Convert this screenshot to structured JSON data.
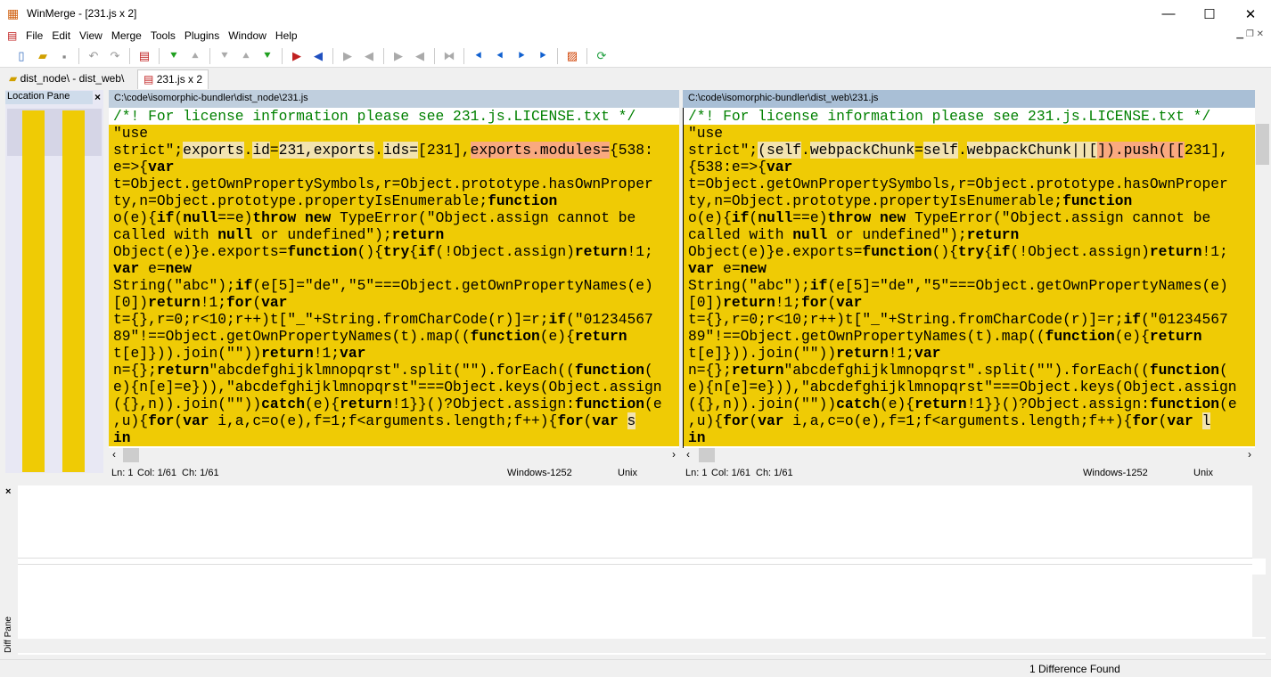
{
  "window": {
    "title": "WinMerge - [231.js x 2]",
    "minimize": "—",
    "maximize": "☐",
    "close": "✕"
  },
  "menu": [
    "File",
    "Edit",
    "View",
    "Merge",
    "Tools",
    "Plugins",
    "Window",
    "Help"
  ],
  "toolbar": [
    "new-icon",
    "open-icon",
    "save-icon",
    "undo-icon",
    "redo-icon",
    "diff-icon",
    "next-diff-icon",
    "prev-diff-icon",
    "first-diff-icon",
    "last-diff-icon",
    "current-diff-icon",
    "copy-right-icon",
    "copy-left-icon",
    "copy-right-advance-icon",
    "copy-left-advance-icon",
    "all-right-icon",
    "all-left-icon",
    "merge-icon",
    "move-left-icon",
    "move-left2-icon",
    "move-right-icon",
    "move-right2-icon",
    "options-icon",
    "refresh-icon"
  ],
  "tabs": [
    {
      "label": "dist_node\\ - dist_web\\"
    },
    {
      "label": "231.js x 2"
    }
  ],
  "location_pane": {
    "title": "Location Pane",
    "close": "×"
  },
  "diff_pane": {
    "title": "Diff Pane",
    "close": "×"
  },
  "colors": {
    "diff": "#efcb05",
    "word_diff": "#f9a97f",
    "word_hl": "#f2e3b0",
    "comment": "#008000"
  },
  "left": {
    "path": "C:\\code\\isomorphic-bundler\\dist_node\\231.js",
    "lines": [
      [
        [
          "/*! For license information please see 231.js.LICENSE.txt */",
          "cm"
        ]
      ],
      "\"use",
      [
        [
          "strict\";",
          ""
        ],
        [
          "exports",
          "hl"
        ],
        [
          ".",
          ""
        ],
        [
          "id",
          "hl"
        ],
        [
          "=",
          ""
        ],
        [
          "231,exports",
          "hl"
        ],
        [
          ".",
          ""
        ],
        [
          "ids=",
          "hl"
        ],
        [
          "[231],",
          ""
        ],
        [
          "exports.modules=",
          "hd"
        ],
        [
          "{538:",
          ""
        ]
      ],
      "e=>{var",
      "t=Object.getOwnPropertySymbols,r=Object.prototype.hasOwnProper",
      "ty,n=Object.prototype.propertyIsEnumerable;function",
      "o(e){if(null==e)throw new TypeError(\"Object.assign cannot be",
      "called with null or undefined\");return",
      "Object(e)}e.exports=function(){try{if(!Object.assign)return!1;",
      "var e=new",
      "String(\"abc\");if(e[5]=\"de\",\"5\"===Object.getOwnPropertyNames(e)",
      "[0])return!1;for(var",
      "t={},r=0;r<10;r++)t[\"_\"+String.fromCharCode(r)]=r;if(\"01234567",
      "89\"!==Object.getOwnPropertyNames(t).map((function(e){return",
      "t[e]})).join(\"\"))return!1;var",
      "n={};return\"abcdefghijklmnopqrst\".split(\"\").forEach((function(",
      "e){n[e]=e})),\"abcdefghijklmnopqrst\"===Object.keys(Object.assign",
      "({},n)).join(\"\"))catch(e){return!1}}()?Object.assign:function(e",
      [
        [
          ",u){",
          ""
        ],
        [
          "for",
          "kw"
        ],
        [
          "(",
          ""
        ],
        [
          "var",
          "kw"
        ],
        [
          " i,a,c=o(e),f=1;f<arguments.length;f++){",
          ""
        ],
        [
          "for",
          "kw"
        ],
        [
          "(",
          ""
        ],
        [
          "var",
          "kw"
        ],
        [
          " ",
          ""
        ],
        [
          "s",
          "hl"
        ]
      ],
      "in"
    ],
    "status": {
      "ln": "Ln: 1",
      "col": "Col: 1/61",
      "ch": "Ch: 1/61",
      "encoding": "Windows-1252",
      "eol": "Unix"
    }
  },
  "right": {
    "path": "C:\\code\\isomorphic-bundler\\dist_web\\231.js",
    "lines": [
      [
        [
          "/*! For license information please see 231.js.LICENSE.txt */",
          "cm"
        ]
      ],
      "\"use",
      [
        [
          "strict\";",
          ""
        ],
        [
          "(self",
          "hl"
        ],
        [
          ".",
          ""
        ],
        [
          "webpackChunk",
          "hl"
        ],
        [
          "=",
          ""
        ],
        [
          "self",
          "hl"
        ],
        [
          ".",
          ""
        ],
        [
          "webpackChunk||[",
          "hl"
        ],
        [
          "]).push([[",
          "hd"
        ],
        [
          "231],",
          ""
        ]
      ],
      "{538:e=>{var",
      "t=Object.getOwnPropertySymbols,r=Object.prototype.hasOwnProper",
      "ty,n=Object.prototype.propertyIsEnumerable;function",
      "o(e){if(null==e)throw new TypeError(\"Object.assign cannot be",
      "called with null or undefined\");return",
      "Object(e)}e.exports=function(){try{if(!Object.assign)return!1;",
      "var e=new",
      "String(\"abc\");if(e[5]=\"de\",\"5\"===Object.getOwnPropertyNames(e)",
      "[0])return!1;for(var",
      "t={},r=0;r<10;r++)t[\"_\"+String.fromCharCode(r)]=r;if(\"01234567",
      "89\"!==Object.getOwnPropertyNames(t).map((function(e){return",
      "t[e]})).join(\"\"))return!1;var",
      "n={};return\"abcdefghijklmnopqrst\".split(\"\").forEach((function(",
      "e){n[e]=e})),\"abcdefghijklmnopqrst\"===Object.keys(Object.assign",
      "({},n)).join(\"\"))catch(e){return!1}}()?Object.assign:function(e",
      [
        [
          ",u){",
          ""
        ],
        [
          "for",
          "kw"
        ],
        [
          "(",
          ""
        ],
        [
          "var",
          "kw"
        ],
        [
          " i,a,c=o(e),f=1;f<arguments.length;f++){",
          ""
        ],
        [
          "for",
          "kw"
        ],
        [
          "(",
          ""
        ],
        [
          "var",
          "kw"
        ],
        [
          " ",
          ""
        ],
        [
          "l",
          "hl"
        ]
      ],
      "in"
    ],
    "status": {
      "ln": "Ln: 1",
      "col": "Col: 1/61",
      "ch": "Ch: 1/61",
      "encoding": "Windows-1252",
      "eol": "Unix"
    }
  },
  "statusbar": {
    "message": "1 Difference Found"
  }
}
